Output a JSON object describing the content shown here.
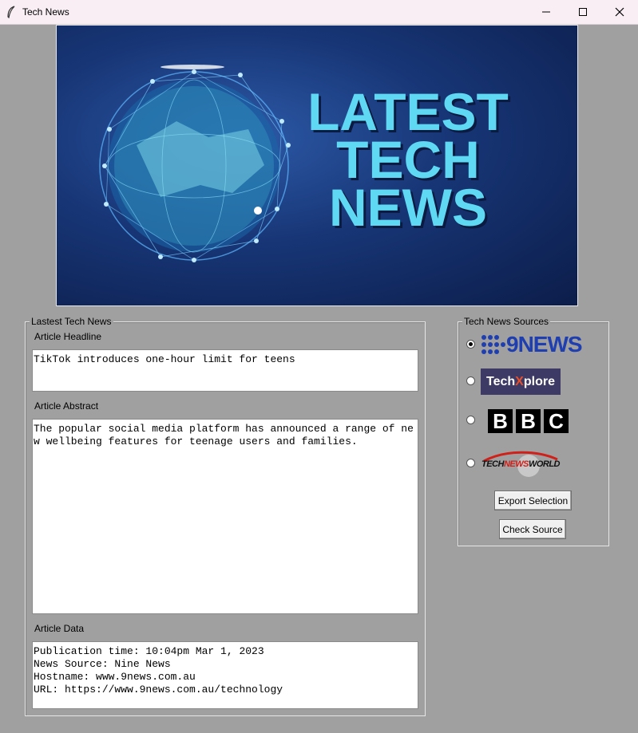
{
  "window": {
    "title": "Tech News",
    "icon": "feather-icon"
  },
  "banner": {
    "lines": [
      "LATEST",
      "TECH",
      "NEWS"
    ],
    "icon": "globe-network-icon"
  },
  "news": {
    "group_label": "Lastest Tech News",
    "headline_label": "Article Headline",
    "headline": "TikTok introduces one-hour limit for teens",
    "abstract_label": "Article Abstract",
    "abstract": "The popular social media platform has announced a range of new wellbeing features for teenage users and families.",
    "data_label": "Article Data",
    "data": "Publication time: 10:04pm Mar 1, 2023\nNews Source: Nine News\nHostname: www.9news.com.au\nURL: https://www.9news.com.au/technology"
  },
  "sources": {
    "group_label": "Tech News Sources",
    "options": [
      {
        "logo": "9NEWS",
        "selected": true
      },
      {
        "logo": "TechXplore",
        "logo_parts": [
          "Tech",
          "X",
          "plore"
        ],
        "selected": false
      },
      {
        "logo": "BBC",
        "letters": [
          "B",
          "B",
          "C"
        ],
        "selected": false
      },
      {
        "logo": "TECHNEWSWORLD",
        "logo_parts": [
          "TECH",
          "NEWS",
          "WORLD"
        ],
        "selected": false
      }
    ],
    "export_button": "Export Selection",
    "check_button": "Check Source"
  },
  "colors": {
    "nine_blue": "#1f3fb0",
    "techxplore_bg": "#3d3a66",
    "techxplore_accent": "#e8502a",
    "banner_text": "#5fd8f4",
    "tnw_red": "#d0201a"
  }
}
